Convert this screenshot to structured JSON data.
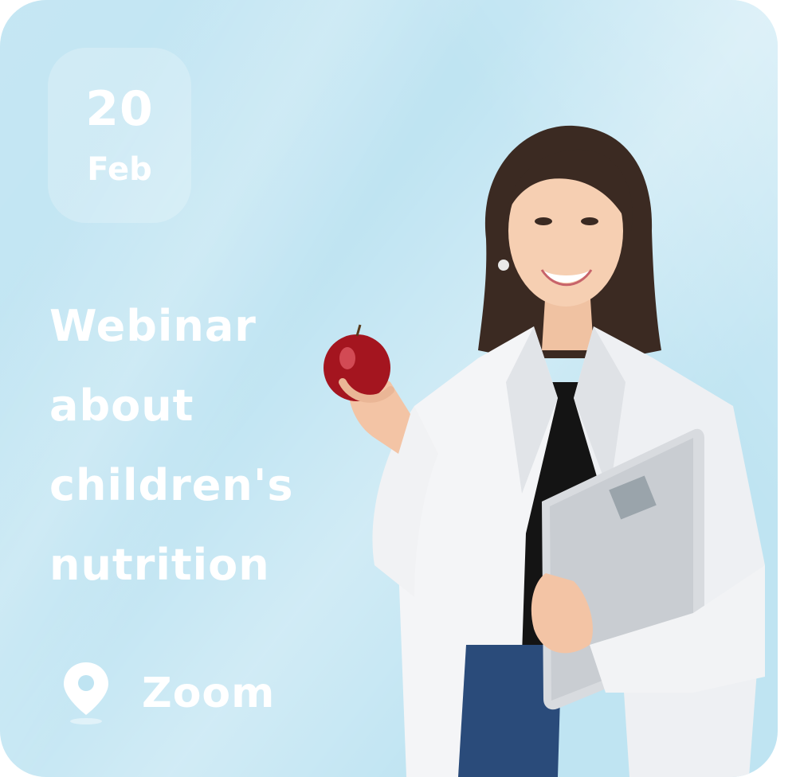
{
  "event": {
    "date_day": "20",
    "date_month": "Feb",
    "title_lines": [
      "Webinar",
      "about",
      "children's",
      "nutrition"
    ],
    "location": "Zoom"
  },
  "icons": {
    "location": "location-pin-icon"
  },
  "colors": {
    "background": "#bfe4f2",
    "text": "#ffffff",
    "badge": "rgba(255,255,255,0.22)"
  }
}
